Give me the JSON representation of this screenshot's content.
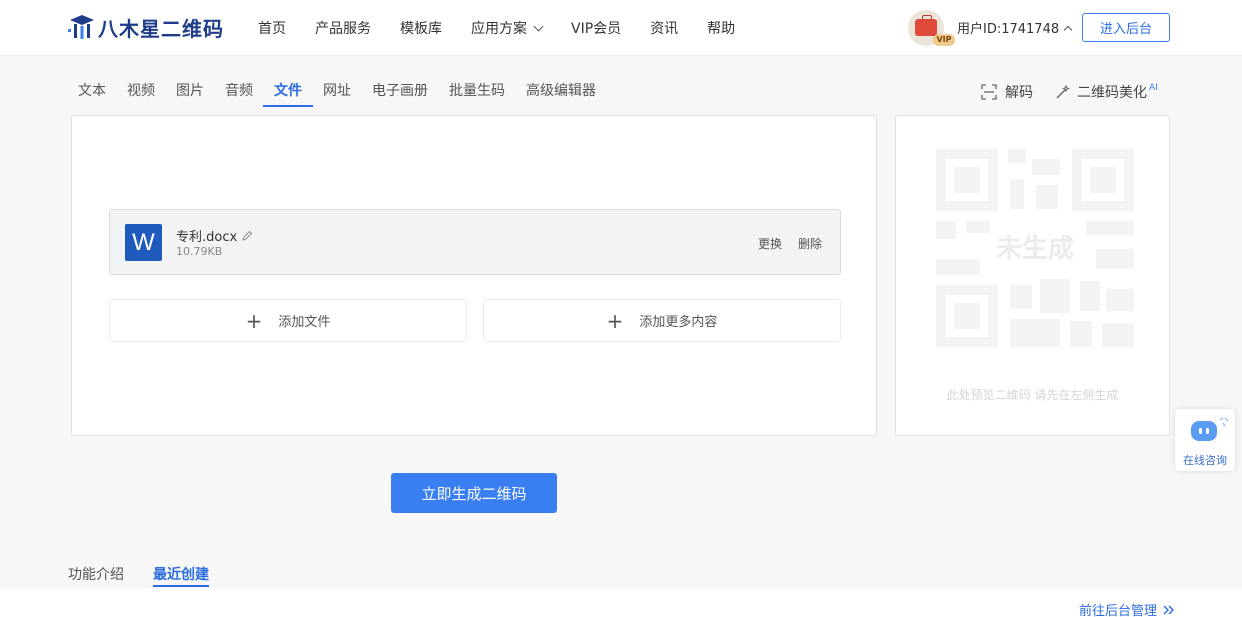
{
  "header": {
    "logo_text": "八木星二维码",
    "nav": [
      {
        "label": "首页"
      },
      {
        "label": "产品服务"
      },
      {
        "label": "模板库"
      },
      {
        "label": "应用方案"
      },
      {
        "label": "VIP会员"
      },
      {
        "label": "资讯"
      },
      {
        "label": "帮助"
      }
    ],
    "vip_badge": "VIP",
    "user_id": "用户ID:1741748",
    "enter_label": "进入后台"
  },
  "tabs": [
    {
      "label": "文本"
    },
    {
      "label": "视频"
    },
    {
      "label": "图片"
    },
    {
      "label": "音频"
    },
    {
      "label": "文件",
      "active": true
    },
    {
      "label": "网址"
    },
    {
      "label": "电子画册"
    },
    {
      "label": "批量生码"
    },
    {
      "label": "高级编辑器"
    }
  ],
  "tools": {
    "decode_label": "解码",
    "beautify_label": "二维码美化",
    "beautify_sup": "AI"
  },
  "file": {
    "icon_letter": "W",
    "name": "专利.docx",
    "size": "10.79KB",
    "replace_label": "更换",
    "delete_label": "删除"
  },
  "add_buttons": {
    "add_file_label": "添加文件",
    "add_more_label": "添加更多内容"
  },
  "preview": {
    "ghost_text": "未生成",
    "hint": "此处预览二维码 请先在左侧生成"
  },
  "generate_label": "立即生成二维码",
  "bottom": {
    "tabs": [
      {
        "label": "功能介绍"
      },
      {
        "label": "最近创建",
        "active": true
      }
    ],
    "manage_link": "前往后台管理"
  },
  "chat": {
    "label": "在线咨询"
  },
  "colors": {
    "accent": "#2b6de0",
    "button": "#3a7ff2",
    "logo": "#1f3d8a",
    "word": "#1e5bbd"
  }
}
